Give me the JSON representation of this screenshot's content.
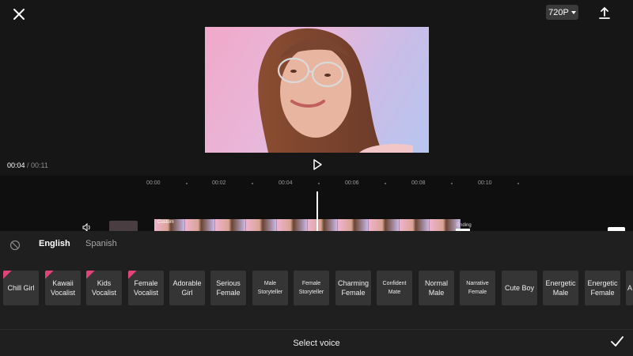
{
  "header": {
    "close_icon": "close-icon",
    "resolution": "720P",
    "export_icon": "export-icon"
  },
  "player": {
    "current_time": "00:04",
    "separator": " / ",
    "total_time": "00:11",
    "play_icon": "play-icon"
  },
  "timeline": {
    "ruler": [
      "00:00",
      "00:02",
      "00:04",
      "00:06",
      "00:08",
      "00:10"
    ],
    "custom_label": "Custom",
    "ending_label": "Ending"
  },
  "voice_panel": {
    "tabs": [
      "English",
      "Spanish"
    ],
    "active_tab": "English",
    "voices": [
      {
        "label": "Chill Girl",
        "new": true
      },
      {
        "label": "Kawaii Vocalist",
        "new": true
      },
      {
        "label": "Kids Vocalist",
        "new": true
      },
      {
        "label": "Female Vocalist",
        "new": true
      },
      {
        "label": "Adorable Girl",
        "new": false
      },
      {
        "label": "Serious Female",
        "new": false
      },
      {
        "label": "Male Storyteller",
        "new": false
      },
      {
        "label": "Female Storyteller",
        "new": false
      },
      {
        "label": "Charming Female",
        "new": false
      },
      {
        "label": "Confident Mate",
        "new": false
      },
      {
        "label": "Normal Male",
        "new": false
      },
      {
        "label": "Narrative Female",
        "new": false
      },
      {
        "label": "Cute Boy",
        "new": false
      },
      {
        "label": "Energetic Male",
        "new": false
      },
      {
        "label": "Energetic Female",
        "new": false
      },
      {
        "label": "A",
        "new": false
      }
    ],
    "footer_title": "Select voice"
  },
  "colors": {
    "background": "#161616",
    "panel": "#1f1f1f",
    "card": "#353535",
    "new_badge": "#e0447a",
    "preview_pink": "#f0a9c9",
    "preview_blue": "#b7c6ef"
  }
}
